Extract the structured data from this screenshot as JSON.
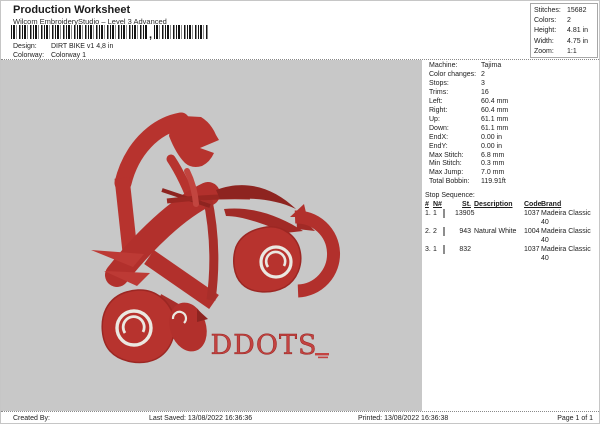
{
  "header": {
    "title": "Production Worksheet",
    "subtitle": "Wilcom EmbroideryStudio – Level 3 Advanced",
    "design_label": "Design:",
    "design_value": "DIRT BIKE v1 4,8 in",
    "colorway_label": "Colorway:",
    "colorway_value": "Colorway 1",
    "barcode_comma": ","
  },
  "stats_box": {
    "rows": [
      {
        "label": "Stitches:",
        "value": "15682"
      },
      {
        "label": "Colors:",
        "value": "2"
      },
      {
        "label": "Height:",
        "value": "4.81 in"
      },
      {
        "label": "Width:",
        "value": "4.75 in"
      },
      {
        "label": "Zoom:",
        "value": "1:1"
      }
    ]
  },
  "machine_info": {
    "rows": [
      {
        "label": "Machine:",
        "value": "Tajima"
      },
      {
        "label": "Color changes:",
        "value": "2"
      },
      {
        "label": "Stops:",
        "value": "3"
      },
      {
        "label": "Trims:",
        "value": "16"
      },
      {
        "label": "Left:",
        "value": "60.4 mm"
      },
      {
        "label": "Right:",
        "value": "60.4 mm"
      },
      {
        "label": "Up:",
        "value": "61.1 mm"
      },
      {
        "label": "Down:",
        "value": "61.1 mm"
      },
      {
        "label": "EndX:",
        "value": "0.00 in"
      },
      {
        "label": "EndY:",
        "value": "0.00 in"
      },
      {
        "label": "Max Stitch:",
        "value": "6.8 mm"
      },
      {
        "label": "Min Stitch:",
        "value": "0.3 mm"
      },
      {
        "label": "Max Jump:",
        "value": "7.0 mm"
      },
      {
        "label": "Total Bobbin:",
        "value": "119.91ft"
      }
    ]
  },
  "stop_sequence": {
    "title": "Stop Sequence:",
    "columns": [
      "#",
      "N#",
      "St.",
      "Description",
      "Code",
      "Brand"
    ],
    "rows": [
      {
        "num": "1.",
        "n": "1",
        "swatch": "#b01f24",
        "st": "13905",
        "description": "",
        "code": "1037",
        "brand": "Madeira Classic 40"
      },
      {
        "num": "2.",
        "n": "2",
        "swatch": "#efede8",
        "st": "943",
        "description": "Natural White",
        "code": "1004",
        "brand": "Madeira Classic 40"
      },
      {
        "num": "3.",
        "n": "1",
        "swatch": "#b01f24",
        "st": "832",
        "description": "",
        "code": "1037",
        "brand": "Madeira Classic 40"
      }
    ]
  },
  "design_preview": {
    "text": "DDOTS",
    "colors": {
      "thread_red": "#b7332e",
      "thread_dark_red": "#8e2420",
      "natural_white": "#eae8e1",
      "canvas_background": "#c8c8c8"
    }
  },
  "footer": {
    "created_by": "Created By:",
    "last_saved": "Last Saved: 13/08/2022 16:36:36",
    "printed": "Printed: 13/08/2022 16:36:38",
    "page": "Page 1 of 1"
  }
}
